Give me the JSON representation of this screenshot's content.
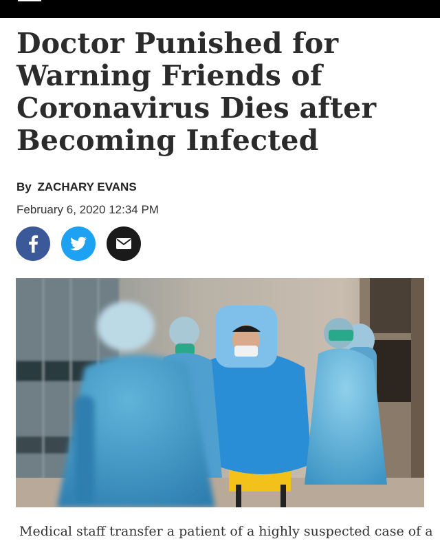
{
  "article": {
    "headline": "Doctor Punished for Warning Friends of Coronavirus Dies after Becoming Infected",
    "byline_prefix": "By",
    "author": "ZACHARY EVANS",
    "date": "February 6, 2020 12:34 PM",
    "caption": "Medical staff transfer a patient of a highly suspected case of a"
  },
  "share": {
    "facebook_icon": "facebook-icon",
    "twitter_icon": "twitter-icon",
    "email_icon": "email-icon",
    "colors": {
      "facebook": "#3b5998",
      "twitter": "#1da1f2",
      "email": "#1a1a1a"
    }
  },
  "topbar": {
    "icon": "menu-icon",
    "color": "#000000"
  }
}
